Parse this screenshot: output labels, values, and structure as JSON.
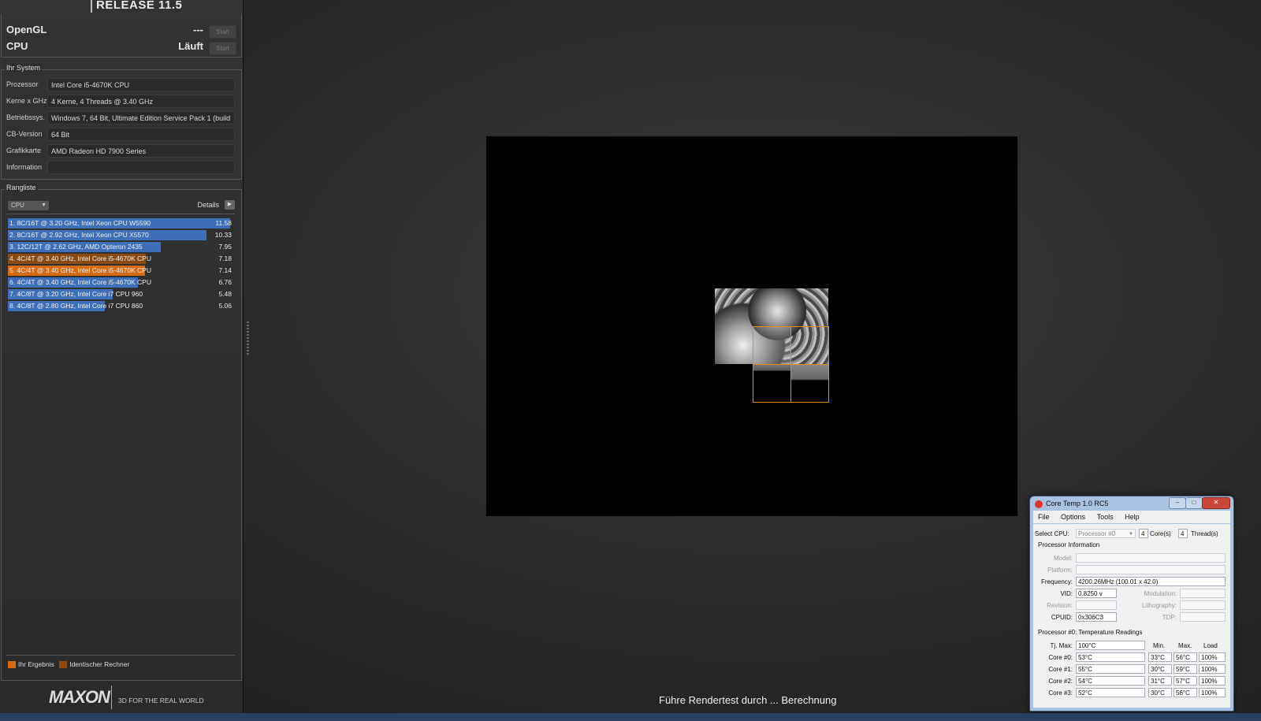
{
  "header": {
    "release": "RELEASE 11.5"
  },
  "tests": [
    {
      "label": "OpenGL",
      "value": "---",
      "button": "Start"
    },
    {
      "label": "CPU",
      "value": "Läuft",
      "button": "Start"
    }
  ],
  "system": {
    "title": "Ihr System",
    "rows": [
      {
        "key": "Prozessor",
        "value": "Intel Core i5-4670K CPU"
      },
      {
        "key": "Kerne x GHz",
        "value": "4 Kerne, 4 Threads @ 3.40 GHz"
      },
      {
        "key": "Betriebssys.",
        "value": "Windows 7, 64 Bit, Ultimate Edition Service Pack 1 (build 7601)"
      },
      {
        "key": "CB-Version",
        "value": "64 Bit"
      },
      {
        "key": "Grafikkarte",
        "value": "AMD Radeon HD 7900 Series"
      },
      {
        "key": "Information",
        "value": ""
      }
    ]
  },
  "ranking": {
    "title": "Rangliste",
    "select": "CPU",
    "details": "Details",
    "max": 11.58,
    "rows": [
      {
        "label": "1. 8C/16T @ 3.20 GHz, Intel Xeon CPU W5590",
        "score": "11.58",
        "value": 11.58,
        "color": "#3f6fb8"
      },
      {
        "label": "2. 8C/16T @ 2.92 GHz, Intel Xeon CPU X5570",
        "score": "10.33",
        "value": 10.33,
        "color": "#3f6fb8"
      },
      {
        "label": "3. 12C/12T @ 2.62 GHz, AMD Opteron 2435",
        "score": "7.95",
        "value": 7.95,
        "color": "#3f6fb8"
      },
      {
        "label": "4. 4C/4T @ 3.40 GHz, Intel Core i5-4670K CPU",
        "score": "7.18",
        "value": 7.18,
        "color": "#8a4a12"
      },
      {
        "label": "5. 4C/4T @ 3.40 GHz, Intel Core i5-4670K CPU",
        "score": "7.14",
        "value": 7.14,
        "color": "#d46b12"
      },
      {
        "label": "6. 4C/4T @ 3.40 GHz, Intel Core i5-4670K CPU",
        "score": "6.76",
        "value": 6.76,
        "color": "#3f6fb8"
      },
      {
        "label": "7. 4C/8T @ 3.20 GHz, Intel Core i7 CPU 960",
        "score": "5.48",
        "value": 5.48,
        "color": "#3f6fb8"
      },
      {
        "label": "8. 4C/8T @ 2.80 GHz, Intel Core i7 CPU 860",
        "score": "5.06",
        "value": 5.06,
        "color": "#3f6fb8"
      }
    ]
  },
  "legend": {
    "yours": "Ihr Ergebnis",
    "identical": "Identischer Rechner",
    "yours_color": "#d46b12",
    "identical_color": "#8a4a12"
  },
  "brand": {
    "logo": "MAXON",
    "tagline": "3D FOR THE REAL WORLD"
  },
  "status": "Führe Rendertest durch ... Berechnung",
  "coretemp": {
    "title": "Core Temp 1.0 RC5",
    "menu": [
      "File",
      "Options",
      "Tools",
      "Help"
    ],
    "select_cpu_label": "Select CPU:",
    "select_cpu_value": "Processor #0",
    "cores": "4",
    "cores_label": "Core(s)",
    "threads": "4",
    "threads_label": "Thread(s)",
    "proc_info_title": "Processor Information",
    "model_label": "Model:",
    "platform_label": "Platform:",
    "frequency_label": "Frequency:",
    "frequency": "4200.26MHz (100.01 x 42.0)",
    "vid_label": "VID:",
    "vid": "0.8250 v",
    "modulation_label": "Modulation:",
    "revision_label": "Revision:",
    "lithography_label": "Lithography:",
    "cpuid_label": "CPUID:",
    "cpuid": "0x306C3",
    "tdp_label": "TDP:",
    "temps_title": "Processor #0: Temperature Readings",
    "tjmax_label": "Tj. Max:",
    "tjmax": "100°C",
    "col_min": "Min.",
    "col_max": "Max.",
    "col_load": "Load",
    "cores_temps": [
      {
        "label": "Core #0:",
        "temp": "53°C",
        "min": "33°C",
        "max": "56°C",
        "load": "100%"
      },
      {
        "label": "Core #1:",
        "temp": "55°C",
        "min": "30°C",
        "max": "59°C",
        "load": "100%"
      },
      {
        "label": "Core #2:",
        "temp": "54°C",
        "min": "31°C",
        "max": "57°C",
        "load": "100%"
      },
      {
        "label": "Core #3:",
        "temp": "52°C",
        "min": "30°C",
        "max": "56°C",
        "load": "100%"
      }
    ]
  }
}
